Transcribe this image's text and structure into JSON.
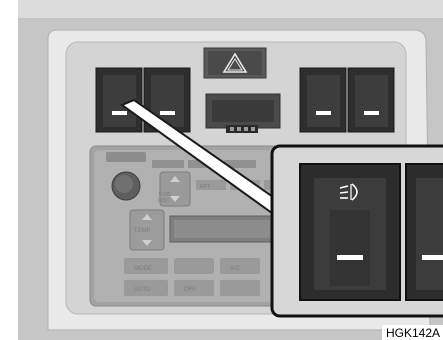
{
  "figure_code": "HGK142A",
  "hazard_symbol": "warning-triangle-icon",
  "fog_light_symbol": "front-fog-light-icon",
  "radio_panel": {
    "tune_label": "TUNE",
    "disc_label": "DISC",
    "temp_label": "TEMP",
    "mode_label": "MODE",
    "auto_label": "AUTO",
    "off_label": "OFF",
    "ac_label": "A/C",
    "rpt_label": "RPT",
    "ps_label": "PS"
  }
}
